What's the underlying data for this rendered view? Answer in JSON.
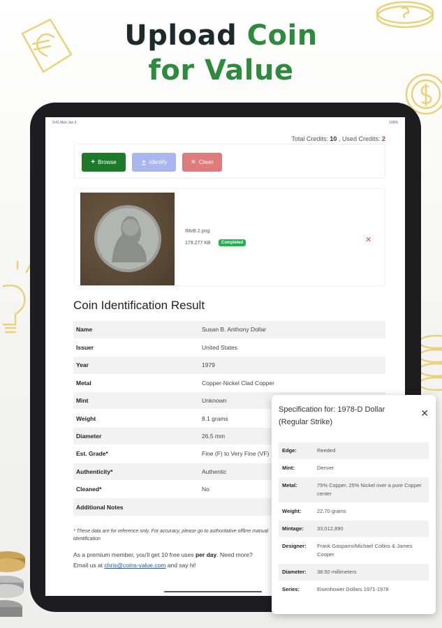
{
  "headline": {
    "line1_dark": "Upload ",
    "line1_green": "Coin",
    "line2_green": "for Value"
  },
  "colors": {
    "brand_green": "#2e8b3d",
    "browse_green": "#1e7a2b",
    "identify_blue": "#a9b6f0",
    "clean_red": "#e07b7b",
    "badge_green": "#22b14c",
    "used_red": "#c0392b"
  },
  "statusbar": {
    "left": "9:41 Mon Jun 3",
    "right": "100%"
  },
  "credits": {
    "total_label": "Total Credits:",
    "total_value": "10",
    "separator": ",",
    "used_label": "Used Credits:",
    "used_value": "2"
  },
  "toolbar": {
    "browse_label": "Browse",
    "identify_label": "Identify",
    "clean_label": "Clean",
    "browse_icon": "plus-icon",
    "identify_icon": "upload-icon",
    "clean_icon": "close-icon"
  },
  "file": {
    "name": "IfdvB 2.png",
    "size": "179.277 KB",
    "status": "Completed"
  },
  "result": {
    "title": "Coin Identification Result",
    "rows": [
      {
        "key": "Name",
        "value": "Susan B. Anthony Dollar"
      },
      {
        "key": "Issuer",
        "value": "United States"
      },
      {
        "key": "Year",
        "value": "1979"
      },
      {
        "key": "Metal",
        "value": "Copper-Nickel Clad Copper"
      },
      {
        "key": "Mint",
        "value": "Unknown"
      },
      {
        "key": "Weight",
        "value": "8.1 grams"
      },
      {
        "key": "Diameter",
        "value": "26.5 mm"
      },
      {
        "key": "Est. Grade*",
        "value": "Fine (F) to Very Fine (VF)"
      },
      {
        "key": "Authenticity*",
        "value": "Authentic"
      },
      {
        "key": "Cleaned*",
        "value": "No"
      },
      {
        "key": "Additional Notes",
        "value": ""
      }
    ]
  },
  "note": "* These data are for reference only. For accuracy, please go to authoritative offline manual identification",
  "premium": {
    "text_before": "As a premium member, you'll get 10 free uses ",
    "bold": "per day",
    "text_after": ". Need more?",
    "email_prefix": "Email us at ",
    "email": "chris@coins-value.com",
    "email_suffix": " and say hi!"
  },
  "popup": {
    "title": "Specification for: 1978-D Dollar (Regular Strike)",
    "rows": [
      {
        "key": "Edge:",
        "value": "Reeded"
      },
      {
        "key": "Mint:",
        "value": "Denver"
      },
      {
        "key": "Metal:",
        "value": "75% Copper, 25% Nickel over a pure Copper center"
      },
      {
        "key": "Weight:",
        "value": "22.70 grams"
      },
      {
        "key": "Mintage:",
        "value": "33,012,890"
      },
      {
        "key": "Designer:",
        "value": "Frank Gasparro/Michael Collins & James Cooper"
      },
      {
        "key": "Diameter:",
        "value": "38.50 millimeters"
      },
      {
        "key": "Series:",
        "value": "Eisenhower Dollars 1971-1978"
      }
    ]
  }
}
